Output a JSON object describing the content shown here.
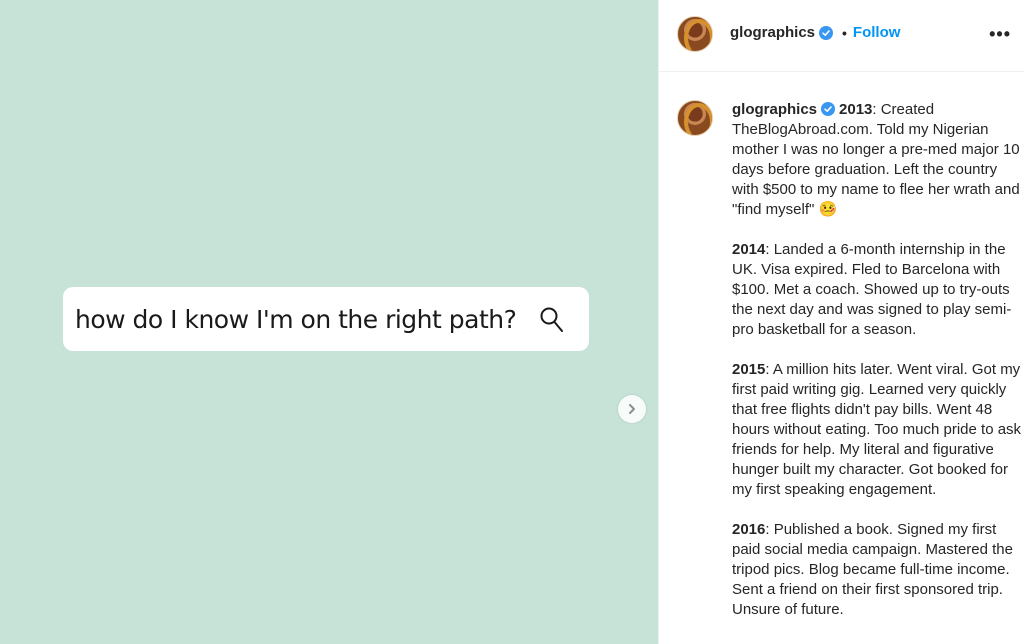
{
  "media": {
    "search_text": "how do I know I'm on the right path?",
    "background_color": "#c7e2d7",
    "search_icon": "search-icon",
    "next_icon": "chevron-right-icon"
  },
  "header": {
    "username": "glographics",
    "separator": "•",
    "follow_label": "Follow",
    "more_label": "•••",
    "verified_icon": "verified-badge-icon",
    "accent_color": "#0095f6"
  },
  "caption": {
    "username": "glographics",
    "paragraphs": [
      {
        "year": "2013",
        "text": ": Created TheBlogAbroad.com. Told my Nigerian mother I was no longer a pre-med major 10 days before graduation. Left the country with $500 to my name to flee her wrath and \"find myself\" 🤒"
      },
      {
        "year": "2014",
        "text": ": Landed a 6-month internship in the UK. Visa expired. Fled to Barcelona with $100. Met a coach. Showed up to try-outs the next day and was signed to play semi-pro basketball for a season."
      },
      {
        "year": "2015",
        "text": ": A million hits later. Went viral. Got my first paid writing gig. Learned very quickly that free flights didn't pay bills. Went 48 hours without eating. Too much pride to ask friends for help. My literal and figurative hunger built my character. Got booked for my first speaking engagement."
      },
      {
        "year": "2016",
        "text": ": Published a book. Signed my first paid social media campaign. Mastered the tripod pics. Blog became full-time income. Sent a friend on their first sponsored trip. Unsure of future."
      }
    ]
  }
}
